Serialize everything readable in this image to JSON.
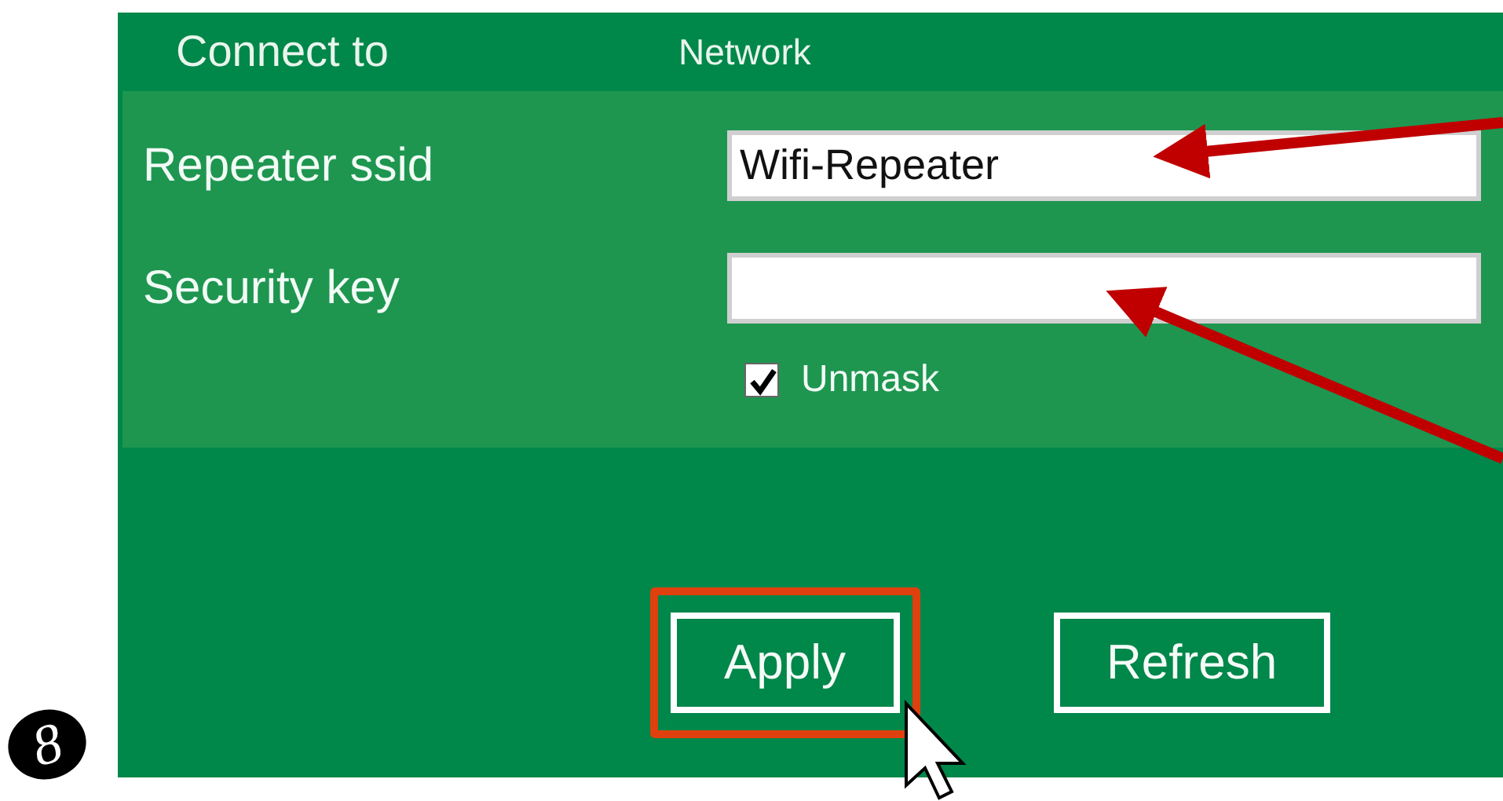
{
  "header": {
    "columns": [
      "Connect to",
      "Network"
    ]
  },
  "fields": [
    {
      "label": "Repeater ssid",
      "value": "Wifi-Repeater"
    },
    {
      "label": "Security key"
    }
  ],
  "checkbox": {
    "label": "Unmask",
    "checked": true
  },
  "buttons": [
    {
      "label": "Apply",
      "highlighted": true
    },
    {
      "label": "Refresh",
      "highlighted": false
    }
  ],
  "step_number": "8"
}
